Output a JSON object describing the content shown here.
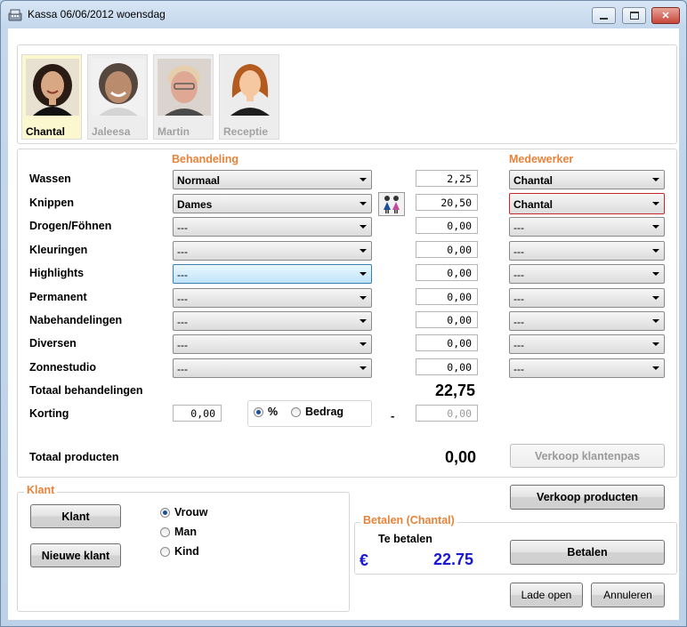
{
  "window": {
    "title": "Kassa 06/06/2012 woensdag"
  },
  "staff": [
    {
      "name": "Chantal",
      "selected": true
    },
    {
      "name": "Jaleesa",
      "selected": false
    },
    {
      "name": "Martin",
      "selected": false
    },
    {
      "name": "Receptie",
      "selected": false
    }
  ],
  "headers": {
    "treatment": "Behandeling",
    "employee": "Medewerker"
  },
  "rows": [
    {
      "label": "Wassen",
      "treatment": "Normaal",
      "price": "2,25",
      "employee": "Chantal"
    },
    {
      "label": "Knippen",
      "treatment": "Dames",
      "price": "20,50",
      "employee": "Chantal"
    },
    {
      "label": "Drogen/Föhnen",
      "treatment": "---",
      "price": "0,00",
      "employee": "---"
    },
    {
      "label": "Kleuringen",
      "treatment": "---",
      "price": "0,00",
      "employee": "---"
    },
    {
      "label": "Highlights",
      "treatment": "---",
      "price": "0,00",
      "employee": "---"
    },
    {
      "label": "Permanent",
      "treatment": "---",
      "price": "0,00",
      "employee": "---"
    },
    {
      "label": "Nabehandelingen",
      "treatment": "---",
      "price": "0,00",
      "employee": "---"
    },
    {
      "label": "Diversen",
      "treatment": "---",
      "price": "0,00",
      "employee": "---"
    },
    {
      "label": "Zonnestudio",
      "treatment": "---",
      "price": "0,00",
      "employee": "---"
    }
  ],
  "totals": {
    "treatments_label": "Totaal behandelingen",
    "treatments_value": "22,75",
    "discount_label": "Korting",
    "discount_input": "0,00",
    "discount_percent": "%",
    "discount_amount": "Bedrag",
    "discount_minus": "-",
    "discount_result": "0,00",
    "products_label": "Totaal producten",
    "products_value": "0,00"
  },
  "buttons": {
    "sell_card": "Verkoop klantenpas",
    "sell_products": "Verkoop producten",
    "client": "Klant",
    "new_client": "Nieuwe klant",
    "pay": "Betalen",
    "open_drawer": "Lade open",
    "cancel": "Annuleren"
  },
  "client_group": {
    "title": "Klant",
    "options": [
      "Vrouw",
      "Man",
      "Kind"
    ],
    "selected": "Vrouw"
  },
  "payment": {
    "title": "Betalen (Chantal)",
    "to_pay_label": "Te betalen",
    "currency": "€",
    "amount": "22.75"
  },
  "colors": {
    "accent": "#e8833a",
    "amount": "#1717d4",
    "selected_staff_bg": "#fbf7cf"
  }
}
